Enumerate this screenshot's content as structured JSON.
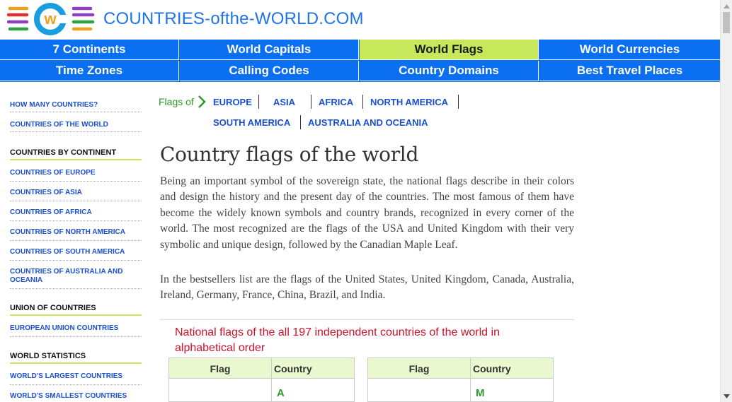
{
  "header": {
    "site_title": "COUNTRIES-ofthe-WORLD.COM",
    "logo_letter": "w"
  },
  "nav": {
    "row1": [
      "7 Continents",
      "World Capitals",
      "World Flags",
      "World Currencies"
    ],
    "row2": [
      "Time Zones",
      "Calling Codes",
      "Country Domains",
      "Best Travel Places"
    ],
    "active": "World Flags"
  },
  "sidebar": {
    "top_links": [
      "HOW MANY COUNTRIES?",
      "COUNTRIES OF THE WORLD"
    ],
    "by_continent": {
      "heading": "COUNTRIES BY CONTINENT",
      "links": [
        "COUNTRIES OF EUROPE",
        "COUNTRIES OF ASIA",
        "COUNTRIES OF AFRICA",
        "COUNTRIES OF NORTH AMERICA",
        "COUNTRIES OF SOUTH AMERICA",
        "COUNTRIES OF AUSTRALIA AND OCEANIA"
      ]
    },
    "union": {
      "heading": "UNION OF COUNTRIES",
      "links": [
        "EUROPEAN UNION COUNTRIES"
      ]
    },
    "stats": {
      "heading": "WORLD STATISTICS",
      "links": [
        "WORLD'S LARGEST COUNTRIES",
        "WORLD'S SMALLEST COUNTRIES"
      ]
    }
  },
  "main": {
    "flags_of_label": "Flags of",
    "continents": [
      "EUROPE",
      "ASIA",
      "AFRICA",
      "NORTH AMERICA",
      "SOUTH AMERICA",
      "AUSTRALIA AND OCEANIA"
    ],
    "title": "Country flags of the world",
    "paragraph1": "Being an important symbol of the sovereign state, the national flags describe in their colors and design the history and the present day of the countries. The most famous of them have become the widely known symbols and country brands, recognized in every corner of the world. The most recognized are the flags of the USA and United Kingdom with their very symbolic and unique design, followed by the Canadian Maple Leaf.",
    "paragraph2": "In the bestsellers list are the flags of the United States, United Kingdom, Canada, Australia, Ireland, Germany, France, China, Brazil, and India.",
    "table_title": "National flags of the all 197 independent countries of the world in alphabetical order",
    "table_headers": {
      "flag": "Flag",
      "country": "Country"
    },
    "table_left_letter": "A",
    "table_right_letter": "M"
  },
  "colors": {
    "nav_blue": "#0a6ff0",
    "nav_active": "#c6e85a",
    "link_blue": "#1a4fd0",
    "accent_red": "#d0102a",
    "green": "#2a9a2a"
  }
}
